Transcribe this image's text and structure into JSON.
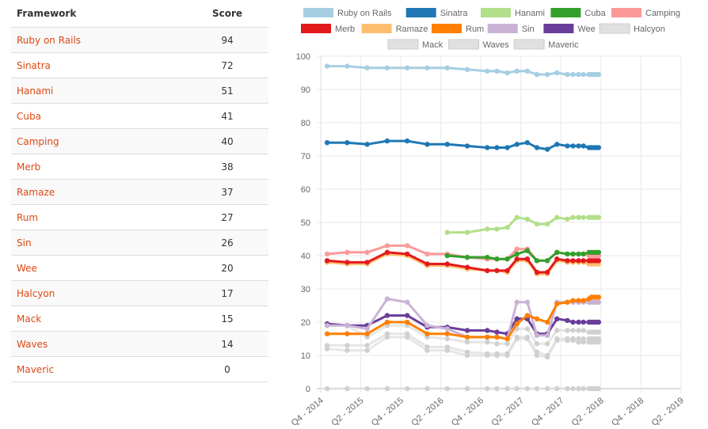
{
  "table": {
    "headers": {
      "framework": "Framework",
      "score": "Score"
    },
    "rows": [
      {
        "name": "Ruby on Rails",
        "score": "94"
      },
      {
        "name": "Sinatra",
        "score": "72"
      },
      {
        "name": "Hanami",
        "score": "51"
      },
      {
        "name": "Cuba",
        "score": "41"
      },
      {
        "name": "Camping",
        "score": "40"
      },
      {
        "name": "Merb",
        "score": "38"
      },
      {
        "name": "Ramaze",
        "score": "37"
      },
      {
        "name": "Rum",
        "score": "27"
      },
      {
        "name": "Sin",
        "score": "26"
      },
      {
        "name": "Wee",
        "score": "20"
      },
      {
        "name": "Halcyon",
        "score": "17"
      },
      {
        "name": "Mack",
        "score": "15"
      },
      {
        "name": "Waves",
        "score": "14"
      },
      {
        "name": "Maveric",
        "score": "0"
      }
    ]
  },
  "chart_data": {
    "type": "line",
    "title": "",
    "xlabel": "",
    "ylabel": "",
    "ylim": [
      0,
      100
    ],
    "yticks": [
      0,
      10,
      20,
      30,
      40,
      50,
      60,
      70,
      80,
      90,
      100
    ],
    "xticks": [
      "Q4 - 2014",
      "Q2 - 2015",
      "Q4 - 2015",
      "Q2 - 2016",
      "Q4 - 2016",
      "Q2 - 2017",
      "Q4 - 2017",
      "Q2 - 2018",
      "Q4 - 2018",
      "Q2 - 2019"
    ],
    "xlim": [
      2014.75,
      2019.25
    ],
    "grid": true,
    "legend": "top",
    "x": [
      2014.83,
      2015.08,
      2015.33,
      2015.58,
      2015.83,
      2016.08,
      2016.33,
      2016.58,
      2016.83,
      2016.95,
      2017.08,
      2017.2,
      2017.33,
      2017.45,
      2017.58,
      2017.7,
      2017.83,
      2017.9,
      2017.97,
      2018.03,
      2018.1,
      2018.13,
      2018.16,
      2018.19,
      2018.22
    ],
    "series": [
      {
        "name": "Ruby on Rails",
        "color": "#a6cee3",
        "values": [
          97,
          97,
          96.5,
          96.5,
          96.5,
          96.5,
          96.5,
          96,
          95.5,
          95.5,
          95,
          95.5,
          95.5,
          94.5,
          94.5,
          95,
          94.5,
          94.5,
          94.5,
          94.5,
          94.5,
          94.5,
          94.5,
          94.5,
          94.5
        ]
      },
      {
        "name": "Sinatra",
        "color": "#1f78b4",
        "values": [
          74,
          74,
          73.5,
          74.5,
          74.5,
          73.5,
          73.5,
          73,
          72.5,
          72.5,
          72.5,
          73.5,
          74,
          72.5,
          72,
          73.5,
          73,
          73,
          73,
          73,
          72.5,
          72.5,
          72.5,
          72.5,
          72.5
        ]
      },
      {
        "name": "Hanami",
        "color": "#b2df8a",
        "values": [
          null,
          null,
          null,
          null,
          null,
          null,
          47,
          47,
          48,
          48,
          48.5,
          51.5,
          51,
          49.5,
          49.5,
          51.5,
          51,
          51.5,
          51.5,
          51.5,
          51.5,
          51.5,
          51.5,
          51.5,
          51.5
        ]
      },
      {
        "name": "Cuba",
        "color": "#33a02c",
        "values": [
          null,
          null,
          null,
          null,
          null,
          null,
          40,
          39.5,
          39.5,
          39,
          39,
          40.5,
          41.5,
          38.5,
          38.5,
          41,
          40.5,
          40.5,
          40.5,
          40.5,
          41,
          41,
          41,
          41,
          41
        ]
      },
      {
        "name": "Camping",
        "color": "#fb9a99",
        "values": [
          40.5,
          41,
          41,
          43,
          43,
          40.5,
          40.5,
          39.5,
          39,
          39,
          39,
          42,
          42,
          38.5,
          38.5,
          41,
          40.5,
          40.5,
          40.5,
          40.5,
          40,
          40,
          40,
          40,
          40
        ]
      },
      {
        "name": "Merb",
        "color": "#e31a1c",
        "values": [
          38.5,
          38,
          38,
          41,
          40.5,
          37.5,
          37.5,
          36.5,
          35.5,
          35.5,
          35.5,
          39,
          39,
          35,
          35,
          39,
          38.5,
          38.5,
          38.5,
          38.5,
          38.5,
          38.5,
          38.5,
          38.5,
          38.5
        ]
      },
      {
        "name": "Ramaze",
        "color": "#fdbf6f",
        "values": [
          38,
          37.5,
          37.5,
          40.5,
          40,
          37,
          37,
          36,
          35.5,
          35.5,
          35,
          38.5,
          38.5,
          34.5,
          34.5,
          38.5,
          38,
          38,
          38,
          38,
          37.5,
          37.5,
          37.5,
          37.5,
          37.5
        ]
      },
      {
        "name": "Rum",
        "color": "#ff7f00",
        "values": [
          16.5,
          16.5,
          16.5,
          20,
          20,
          16.5,
          16.5,
          15.5,
          15.5,
          15.5,
          15,
          19.5,
          22,
          21,
          20,
          25.5,
          26,
          26.5,
          26.5,
          26.5,
          27,
          27.5,
          27.5,
          27.5,
          27.5
        ]
      },
      {
        "name": "Sin",
        "color": "#cab2d6",
        "values": [
          19,
          19,
          18,
          27,
          26,
          19,
          18,
          15.5,
          15.5,
          15.5,
          15,
          26,
          26,
          16,
          16,
          26,
          26,
          26,
          26,
          26,
          26,
          26,
          26,
          26,
          26
        ]
      },
      {
        "name": "Wee",
        "color": "#6a3d9a",
        "values": [
          19.5,
          19,
          19,
          22,
          22,
          18.5,
          18.5,
          17.5,
          17.5,
          17,
          16.5,
          21,
          21,
          16.5,
          16.5,
          21,
          20.5,
          20,
          20,
          20,
          20,
          20,
          20,
          20,
          20
        ]
      },
      {
        "name": "Halcyon",
        "color": "#e0e0e0",
        "values": [
          19,
          19,
          15.5,
          19,
          19,
          15.5,
          15,
          14,
          14,
          13.5,
          13.5,
          18,
          18,
          13.5,
          13.5,
          17.5,
          17.5,
          17.5,
          17.5,
          17.5,
          17,
          17,
          17,
          17,
          17
        ]
      },
      {
        "name": "Mack",
        "color": "#e0e0e0",
        "values": [
          13,
          13,
          13,
          16.5,
          16.5,
          12.5,
          12.5,
          11,
          10.5,
          10.5,
          10.5,
          15.5,
          15.5,
          11,
          10,
          15,
          15,
          15,
          15,
          15,
          15,
          15,
          15,
          15,
          15
        ]
      },
      {
        "name": "Waves",
        "color": "#e0e0e0",
        "values": [
          12,
          11.5,
          11.5,
          15.5,
          15.5,
          11.5,
          11.5,
          10,
          10,
          10,
          10,
          15,
          15,
          10,
          9.5,
          14.5,
          14.5,
          14.5,
          14,
          14,
          14,
          14,
          14,
          14,
          14
        ]
      },
      {
        "name": "Maveric",
        "color": "#e0e0e0",
        "values": [
          0,
          0,
          0,
          0,
          0,
          0,
          0,
          0,
          0,
          0,
          0,
          0,
          0,
          0,
          0,
          0,
          0,
          0,
          0,
          0,
          0,
          0,
          0,
          0,
          0
        ]
      }
    ]
  }
}
